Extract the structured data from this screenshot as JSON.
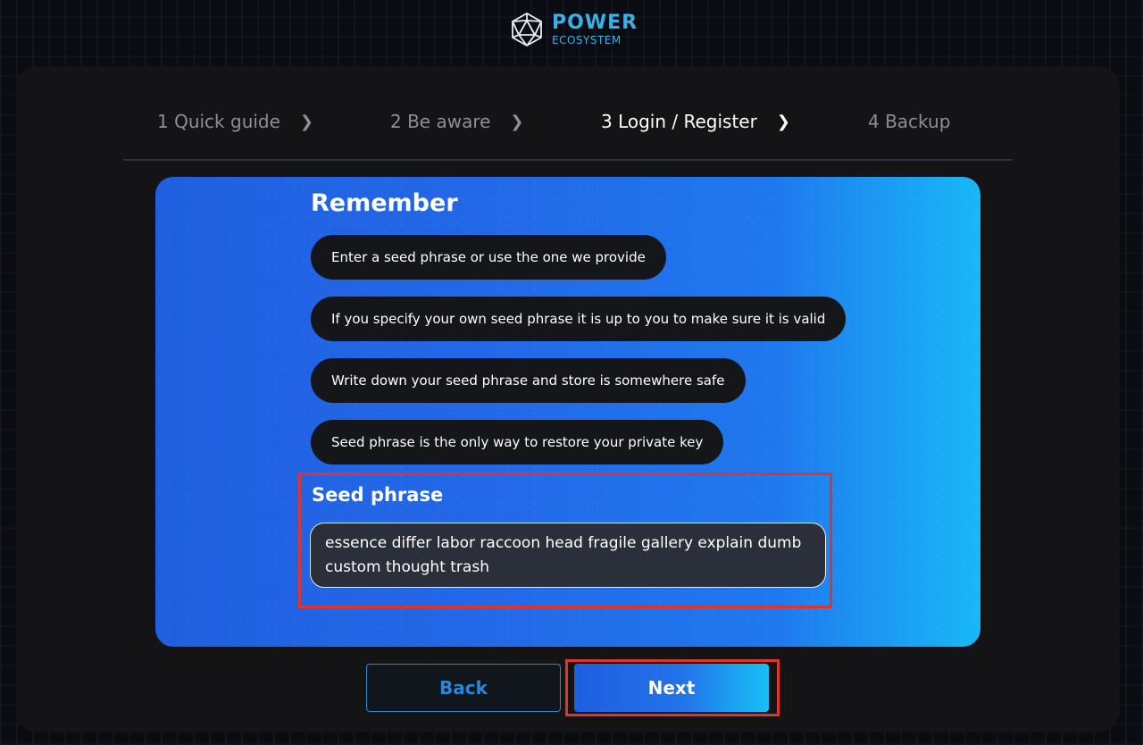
{
  "brand": {
    "name_top": "POWER",
    "name_bottom": "ECOSYSTEM",
    "color": "#3ab0e6"
  },
  "steps": [
    {
      "label": "1 Quick guide",
      "active": false
    },
    {
      "label": "2 Be aware",
      "active": false
    },
    {
      "label": "3 Login / Register",
      "active": true
    },
    {
      "label": "4 Backup",
      "active": false
    }
  ],
  "remember": {
    "title": "Remember",
    "items": [
      "Enter a seed phrase or use the one we provide",
      "If you specify your own seed phrase it is up to you to make sure it is valid",
      "Write down your seed phrase and store is somewhere safe",
      "Seed phrase is the only way to restore your private key"
    ]
  },
  "seed": {
    "label": "Seed phrase",
    "value": "essence differ labor raccoon head fragile gallery explain dumb custom thought trash"
  },
  "buttons": {
    "back": "Back",
    "next": "Next"
  },
  "colors": {
    "accent": "#1f5fe0",
    "accent_end": "#18b8f6",
    "highlight": "#e0332a",
    "panel": "#141417"
  }
}
